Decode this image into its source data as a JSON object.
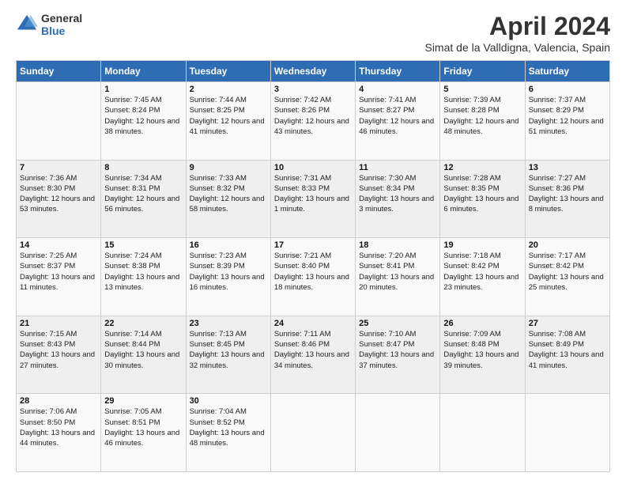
{
  "logo": {
    "line1": "General",
    "line2": "Blue"
  },
  "title": "April 2024",
  "subtitle": "Simat de la Valldigna, Valencia, Spain",
  "days_of_week": [
    "Sunday",
    "Monday",
    "Tuesday",
    "Wednesday",
    "Thursday",
    "Friday",
    "Saturday"
  ],
  "weeks": [
    [
      {
        "day": "",
        "sunrise": "",
        "sunset": "",
        "daylight": ""
      },
      {
        "day": "1",
        "sunrise": "Sunrise: 7:45 AM",
        "sunset": "Sunset: 8:24 PM",
        "daylight": "Daylight: 12 hours and 38 minutes."
      },
      {
        "day": "2",
        "sunrise": "Sunrise: 7:44 AM",
        "sunset": "Sunset: 8:25 PM",
        "daylight": "Daylight: 12 hours and 41 minutes."
      },
      {
        "day": "3",
        "sunrise": "Sunrise: 7:42 AM",
        "sunset": "Sunset: 8:26 PM",
        "daylight": "Daylight: 12 hours and 43 minutes."
      },
      {
        "day": "4",
        "sunrise": "Sunrise: 7:41 AM",
        "sunset": "Sunset: 8:27 PM",
        "daylight": "Daylight: 12 hours and 46 minutes."
      },
      {
        "day": "5",
        "sunrise": "Sunrise: 7:39 AM",
        "sunset": "Sunset: 8:28 PM",
        "daylight": "Daylight: 12 hours and 48 minutes."
      },
      {
        "day": "6",
        "sunrise": "Sunrise: 7:37 AM",
        "sunset": "Sunset: 8:29 PM",
        "daylight": "Daylight: 12 hours and 51 minutes."
      }
    ],
    [
      {
        "day": "7",
        "sunrise": "Sunrise: 7:36 AM",
        "sunset": "Sunset: 8:30 PM",
        "daylight": "Daylight: 12 hours and 53 minutes."
      },
      {
        "day": "8",
        "sunrise": "Sunrise: 7:34 AM",
        "sunset": "Sunset: 8:31 PM",
        "daylight": "Daylight: 12 hours and 56 minutes."
      },
      {
        "day": "9",
        "sunrise": "Sunrise: 7:33 AM",
        "sunset": "Sunset: 8:32 PM",
        "daylight": "Daylight: 12 hours and 58 minutes."
      },
      {
        "day": "10",
        "sunrise": "Sunrise: 7:31 AM",
        "sunset": "Sunset: 8:33 PM",
        "daylight": "Daylight: 13 hours and 1 minute."
      },
      {
        "day": "11",
        "sunrise": "Sunrise: 7:30 AM",
        "sunset": "Sunset: 8:34 PM",
        "daylight": "Daylight: 13 hours and 3 minutes."
      },
      {
        "day": "12",
        "sunrise": "Sunrise: 7:28 AM",
        "sunset": "Sunset: 8:35 PM",
        "daylight": "Daylight: 13 hours and 6 minutes."
      },
      {
        "day": "13",
        "sunrise": "Sunrise: 7:27 AM",
        "sunset": "Sunset: 8:36 PM",
        "daylight": "Daylight: 13 hours and 8 minutes."
      }
    ],
    [
      {
        "day": "14",
        "sunrise": "Sunrise: 7:25 AM",
        "sunset": "Sunset: 8:37 PM",
        "daylight": "Daylight: 13 hours and 11 minutes."
      },
      {
        "day": "15",
        "sunrise": "Sunrise: 7:24 AM",
        "sunset": "Sunset: 8:38 PM",
        "daylight": "Daylight: 13 hours and 13 minutes."
      },
      {
        "day": "16",
        "sunrise": "Sunrise: 7:23 AM",
        "sunset": "Sunset: 8:39 PM",
        "daylight": "Daylight: 13 hours and 16 minutes."
      },
      {
        "day": "17",
        "sunrise": "Sunrise: 7:21 AM",
        "sunset": "Sunset: 8:40 PM",
        "daylight": "Daylight: 13 hours and 18 minutes."
      },
      {
        "day": "18",
        "sunrise": "Sunrise: 7:20 AM",
        "sunset": "Sunset: 8:41 PM",
        "daylight": "Daylight: 13 hours and 20 minutes."
      },
      {
        "day": "19",
        "sunrise": "Sunrise: 7:18 AM",
        "sunset": "Sunset: 8:42 PM",
        "daylight": "Daylight: 13 hours and 23 minutes."
      },
      {
        "day": "20",
        "sunrise": "Sunrise: 7:17 AM",
        "sunset": "Sunset: 8:42 PM",
        "daylight": "Daylight: 13 hours and 25 minutes."
      }
    ],
    [
      {
        "day": "21",
        "sunrise": "Sunrise: 7:15 AM",
        "sunset": "Sunset: 8:43 PM",
        "daylight": "Daylight: 13 hours and 27 minutes."
      },
      {
        "day": "22",
        "sunrise": "Sunrise: 7:14 AM",
        "sunset": "Sunset: 8:44 PM",
        "daylight": "Daylight: 13 hours and 30 minutes."
      },
      {
        "day": "23",
        "sunrise": "Sunrise: 7:13 AM",
        "sunset": "Sunset: 8:45 PM",
        "daylight": "Daylight: 13 hours and 32 minutes."
      },
      {
        "day": "24",
        "sunrise": "Sunrise: 7:11 AM",
        "sunset": "Sunset: 8:46 PM",
        "daylight": "Daylight: 13 hours and 34 minutes."
      },
      {
        "day": "25",
        "sunrise": "Sunrise: 7:10 AM",
        "sunset": "Sunset: 8:47 PM",
        "daylight": "Daylight: 13 hours and 37 minutes."
      },
      {
        "day": "26",
        "sunrise": "Sunrise: 7:09 AM",
        "sunset": "Sunset: 8:48 PM",
        "daylight": "Daylight: 13 hours and 39 minutes."
      },
      {
        "day": "27",
        "sunrise": "Sunrise: 7:08 AM",
        "sunset": "Sunset: 8:49 PM",
        "daylight": "Daylight: 13 hours and 41 minutes."
      }
    ],
    [
      {
        "day": "28",
        "sunrise": "Sunrise: 7:06 AM",
        "sunset": "Sunset: 8:50 PM",
        "daylight": "Daylight: 13 hours and 44 minutes."
      },
      {
        "day": "29",
        "sunrise": "Sunrise: 7:05 AM",
        "sunset": "Sunset: 8:51 PM",
        "daylight": "Daylight: 13 hours and 46 minutes."
      },
      {
        "day": "30",
        "sunrise": "Sunrise: 7:04 AM",
        "sunset": "Sunset: 8:52 PM",
        "daylight": "Daylight: 13 hours and 48 minutes."
      },
      {
        "day": "",
        "sunrise": "",
        "sunset": "",
        "daylight": ""
      },
      {
        "day": "",
        "sunrise": "",
        "sunset": "",
        "daylight": ""
      },
      {
        "day": "",
        "sunrise": "",
        "sunset": "",
        "daylight": ""
      },
      {
        "day": "",
        "sunrise": "",
        "sunset": "",
        "daylight": ""
      }
    ]
  ]
}
